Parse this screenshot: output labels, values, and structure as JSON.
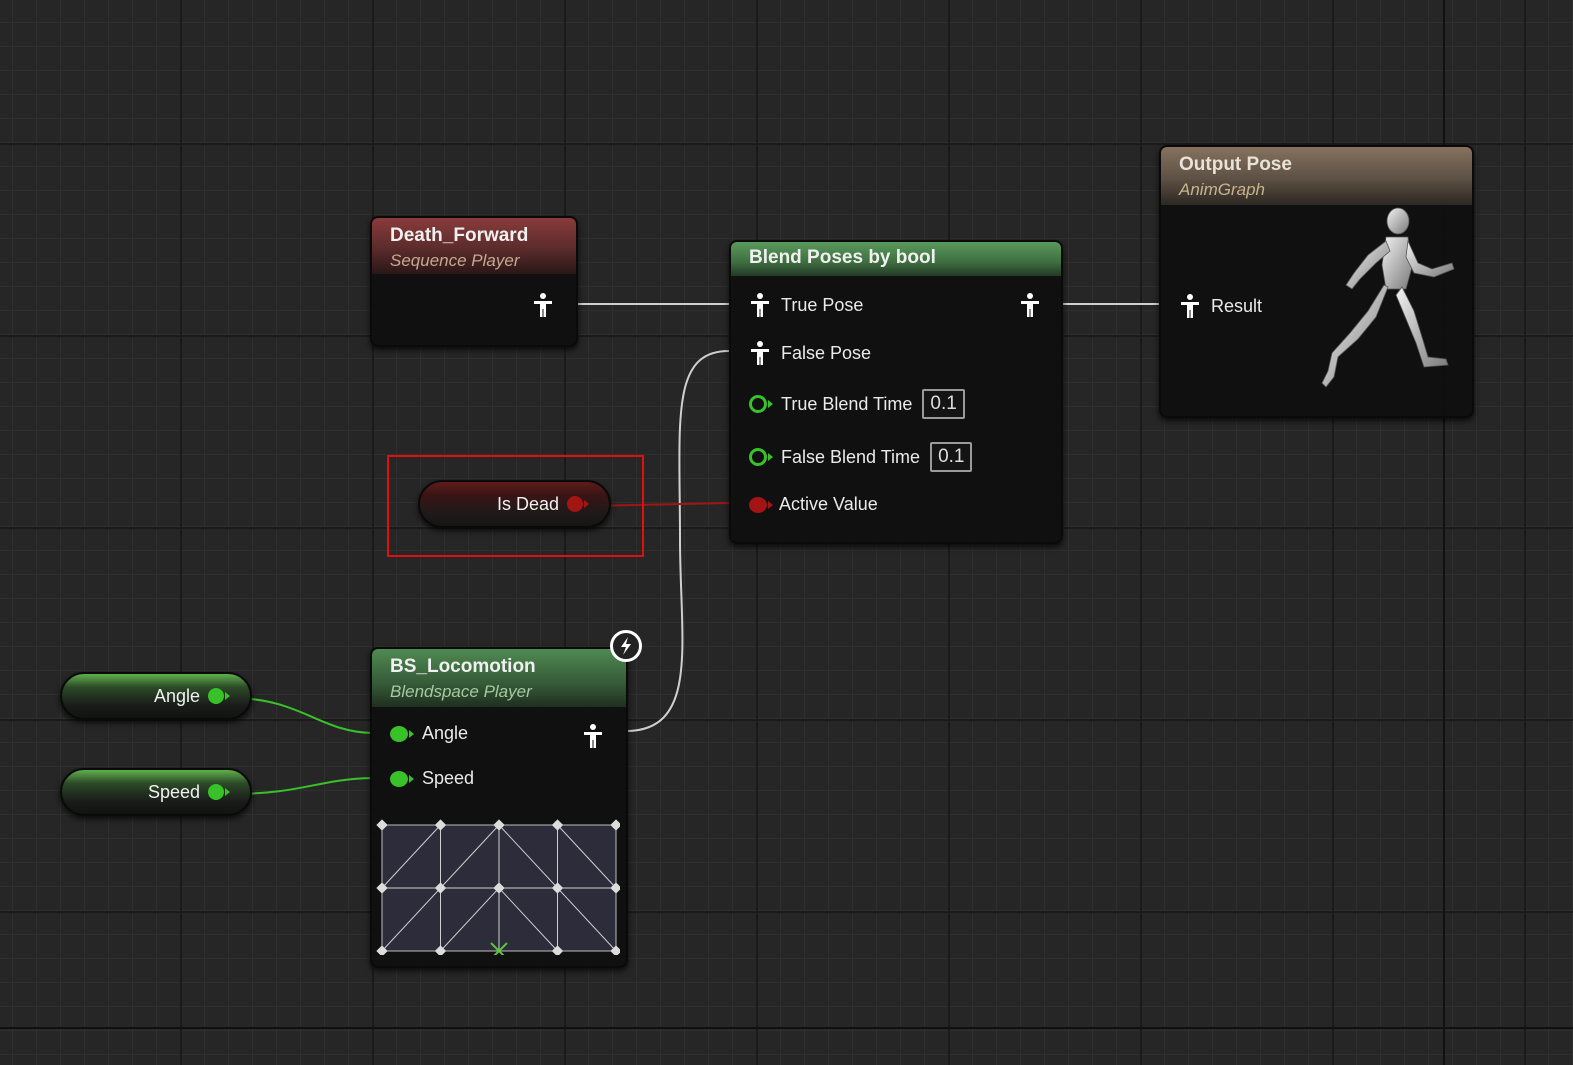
{
  "nodes": {
    "death_forward": {
      "title": "Death_Forward",
      "subtitle": "Sequence Player"
    },
    "blend_poses": {
      "title": "Blend Poses by bool",
      "pins": {
        "true_pose": "True Pose",
        "false_pose": "False Pose",
        "true_blend_time": "True Blend Time",
        "true_blend_time_value": "0.1",
        "false_blend_time": "False Blend Time",
        "false_blend_time_value": "0.1",
        "active_value": "Active Value"
      }
    },
    "output_pose": {
      "title": "Output Pose",
      "subtitle": "AnimGraph",
      "result_label": "Result"
    },
    "is_dead": {
      "label": "Is Dead"
    },
    "bs_locomotion": {
      "title": "BS_Locomotion",
      "subtitle": "Blendspace Player",
      "pins": {
        "angle": "Angle",
        "speed": "Speed"
      }
    },
    "angle_var": {
      "label": "Angle"
    },
    "speed_var": {
      "label": "Speed"
    }
  },
  "colors": {
    "exec_pose_wire": "#cfcfcf",
    "float_pin": "#39c12a",
    "bool_pin": "#a31414",
    "highlight": "#e01010"
  },
  "icons": {
    "pose": "pose-icon",
    "bolt": "lightning-bolt-icon",
    "mannequin": "running-mannequin-icon"
  }
}
